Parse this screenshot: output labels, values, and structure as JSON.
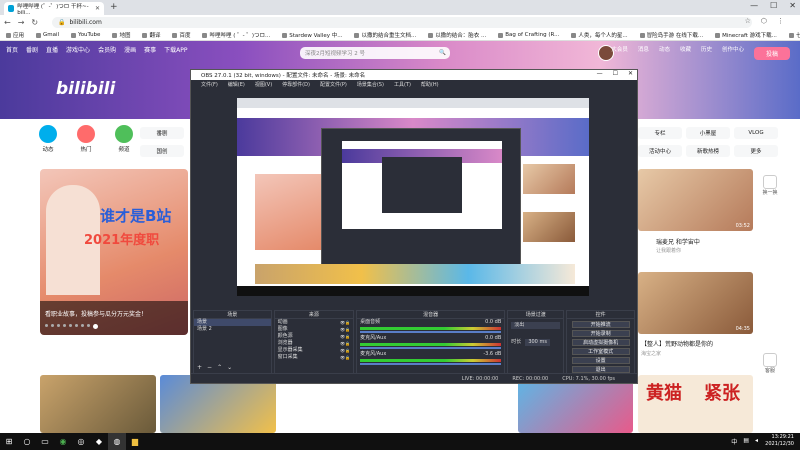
{
  "browser": {
    "tab_title": "哔哩哔哩 (゜-゜)つロ 干杯~-bili...",
    "new_tab": "+",
    "url": "bilibili.com",
    "window_controls": [
      "—",
      "☐",
      "✕"
    ],
    "bookmarks": [
      "应用",
      "Gmail",
      "YouTube",
      "地图",
      "翻译",
      "百度",
      "哔哩哔哩 ( ゜- ゜)つロ...",
      "Stardew Valley 中...",
      "以撒的结合重生文档...",
      "以撒的结合：胎衣 ...",
      "Bag of Crafting (R...",
      "人类，每个人的星...",
      "冒险岛手游 在线下载...",
      "Minecraft 游戏下载...",
      "七日杀攻略 简体中文...",
      "阅读清单"
    ]
  },
  "bili": {
    "top_nav": [
      "首页",
      "番剧",
      "直播",
      "游戏中心",
      "会员购",
      "漫画",
      "赛事",
      "下载APP"
    ],
    "search_placeholder": "深夜2月短视频学习 2 号",
    "right_nav": [
      "大会员",
      "消息",
      "动态",
      "收藏",
      "历史",
      "创作中心"
    ],
    "upload": "投稿",
    "logo": "bilibili",
    "categories": [
      {
        "label": "动态",
        "color": "#00aeec"
      },
      {
        "label": "热门",
        "color": "#ff6b6b"
      },
      {
        "label": "频道",
        "color": "#4fbf5a"
      }
    ],
    "left_chips": [
      "番剧",
      "国创"
    ],
    "right_chips": [
      "专栏",
      "小黑屋",
      "VLOG",
      "活动中心",
      "新歌热榜",
      "更多"
    ],
    "side_buttons": [
      "换一换",
      "客服"
    ],
    "hero": {
      "line1": "谁才是B站",
      "line2": "2021年度职",
      "caption": "看职业故事，投稿参与瓜分万元奖金！"
    },
    "cards": [
      {
        "title": "瑞麦兄 和学宙中",
        "meta": "让我跟着你",
        "duration": "03:52"
      },
      {
        "title": "【整人】荒野动物都是你的",
        "meta": "海宝之家",
        "duration": "04:35"
      }
    ],
    "bottom_cards": [
      "黄猫",
      "紧张"
    ]
  },
  "obs": {
    "title": "OBS 27.0.1 (32 bit, windows) - 配置文件: 未命名 - 场景: 未命名",
    "menu": [
      "文件(F)",
      "编辑(E)",
      "视图(V)",
      "停靠部件(D)",
      "配置文件(P)",
      "场景集合(S)",
      "工具(T)",
      "帮助(H)"
    ],
    "docks": {
      "scenes": {
        "header": "场景",
        "items": [
          "场景",
          "场景 2"
        ]
      },
      "sources": {
        "header": "来源",
        "items": [
          "动画",
          "图像",
          "颜色源",
          "浏览器",
          "显示器采集",
          "窗口采集"
        ]
      },
      "mixer": {
        "header": "混音器",
        "tracks": [
          {
            "name": "桌面音频",
            "level": "0.0 dB"
          },
          {
            "name": "麦克风/Aux",
            "level": "0.0 dB"
          },
          {
            "name": "麦克风/Aux",
            "level": "-3.6 dB"
          }
        ]
      },
      "transitions": {
        "header": "场景过渡",
        "mode": "淡出",
        "duration_label": "时长",
        "duration": "300 ms"
      },
      "controls": {
        "header": "控件",
        "buttons": [
          "开始推流",
          "开始录制",
          "启动虚拟摄像机",
          "工作室模式",
          "设置",
          "退出"
        ]
      }
    },
    "status": [
      "LIVE: 00:00:00",
      "REC: 00:00:00",
      "CPU: 7.1%, 30.00 fps"
    ]
  },
  "taskbar": {
    "time": "13:29:21",
    "date": "2021/12/30",
    "lang": "中"
  }
}
